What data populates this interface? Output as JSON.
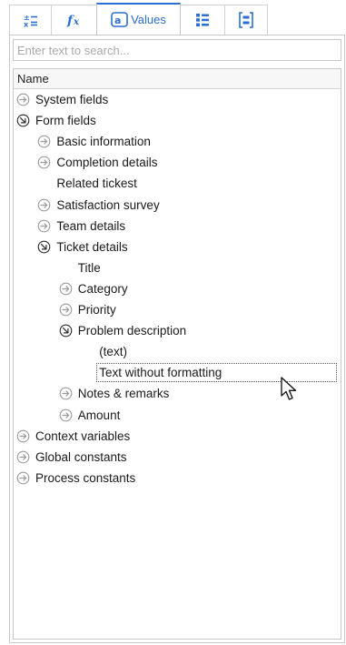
{
  "tabs": [
    {
      "icon": "variable-assign-icon",
      "label": ""
    },
    {
      "icon": "function-icon",
      "label": ""
    },
    {
      "icon": "values-icon",
      "label": "Values",
      "active": true
    },
    {
      "icon": "list-icon",
      "label": ""
    },
    {
      "icon": "bracket-list-icon",
      "label": ""
    }
  ],
  "search": {
    "placeholder": "Enter text to search...",
    "value": ""
  },
  "tree": {
    "header": "Name",
    "nodes": [
      {
        "label": "System fields",
        "level": 0,
        "state": "collapsed"
      },
      {
        "label": "Form fields",
        "level": 0,
        "state": "expanded"
      },
      {
        "label": "Basic information",
        "level": 1,
        "state": "collapsed"
      },
      {
        "label": "Completion details",
        "level": 1,
        "state": "collapsed"
      },
      {
        "label": "Related tickest",
        "level": 1,
        "state": "leaf"
      },
      {
        "label": "Satisfaction survey",
        "level": 1,
        "state": "collapsed"
      },
      {
        "label": "Team details",
        "level": 1,
        "state": "collapsed"
      },
      {
        "label": "Ticket details",
        "level": 1,
        "state": "expanded"
      },
      {
        "label": "Title",
        "level": 2,
        "state": "leaf"
      },
      {
        "label": "Category",
        "level": 2,
        "state": "collapsed"
      },
      {
        "label": "Priority",
        "level": 2,
        "state": "collapsed"
      },
      {
        "label": "Problem description",
        "level": 2,
        "state": "expanded"
      },
      {
        "label": "(text)",
        "level": 3,
        "state": "leaf"
      },
      {
        "label": "Text without formatting",
        "level": 3,
        "state": "leaf",
        "selected": true
      },
      {
        "label": "Notes & remarks",
        "level": 2,
        "state": "collapsed"
      },
      {
        "label": "Amount",
        "level": 2,
        "state": "collapsed"
      },
      {
        "label": "Context variables",
        "level": 0,
        "state": "collapsed"
      },
      {
        "label": "Global constants",
        "level": 0,
        "state": "collapsed"
      },
      {
        "label": "Process constants",
        "level": 0,
        "state": "collapsed"
      }
    ]
  },
  "colors": {
    "accent": "#2b6fd0",
    "border": "#c8c8c8",
    "node_icon": "#9a9a9a",
    "node_icon_expanded": "#2b2b2b"
  }
}
